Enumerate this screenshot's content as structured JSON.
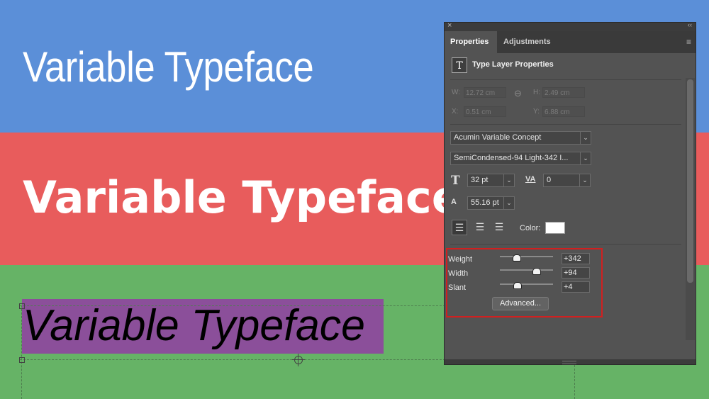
{
  "canvas": {
    "sample_text_1": "Variable Typeface",
    "sample_text_2": "Variable Typeface",
    "sample_text_3": "Variable Typeface",
    "band_colors": [
      "#5b8fd8",
      "#e85c5c",
      "#66b366"
    ],
    "selection_color": "#8b4f9a"
  },
  "panel": {
    "close_icon": "×",
    "collapse_icon": "‹‹",
    "tabs": [
      "Properties",
      "Adjustments"
    ],
    "menu_icon": "≡",
    "header_icon": "T",
    "header_title": "Type Layer Properties",
    "transform": {
      "w_label": "W:",
      "w_value": "12.72 cm",
      "h_label": "H:",
      "h_value": "2.49 cm",
      "x_label": "X:",
      "x_value": "0.51 cm",
      "y_label": "Y:",
      "y_value": "6.88 cm"
    },
    "font_family": "Acumin Variable Concept",
    "font_style": "SemiCondensed-94 Light-342 I...",
    "size_icon": "T",
    "font_size": "32 pt",
    "tracking_icon": "VA",
    "tracking": "0",
    "leading_icon": "A",
    "leading": "55.16 pt",
    "align_icons": [
      "align-left",
      "align-center",
      "align-right"
    ],
    "color_label": "Color:",
    "color_value": "#ffffff",
    "axes": [
      {
        "label": "Weight",
        "value": "+342",
        "position": 0.3
      },
      {
        "label": "Width",
        "value": "+94",
        "position": 0.68
      },
      {
        "label": "Slant",
        "value": "+4",
        "position": 0.32
      }
    ],
    "advanced_button": "Advanced..."
  }
}
